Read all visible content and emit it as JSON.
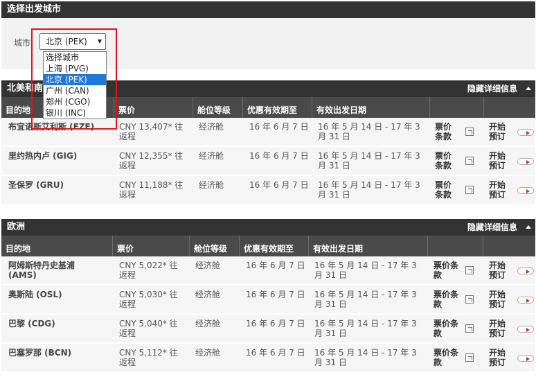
{
  "city_section": {
    "title": "选择出发城市",
    "city_label": "城市",
    "selected": "北京 (PEK)",
    "options": [
      "选择城市",
      "上海 (PVG)",
      "北京 (PEK)",
      "广州 (CAN)",
      "郑州 (CGO)",
      "银川 (INC)"
    ],
    "selected_index": 2
  },
  "sections": [
    {
      "title": "北美和南",
      "toggle": "隐藏详细信息",
      "headers": [
        "目的地",
        "票价",
        "舱位等级",
        "优惠有效期至",
        "有效出发日期"
      ],
      "rows": [
        {
          "dest": "布宜诺斯艾利斯 (EZE)",
          "fare": "CNY 13,407* 往返程",
          "cabin": "经济舱",
          "valid_until": "16 年 6 月 7 日",
          "travel": "16 年 5 月 14 日 - 17 年 3 月 31 日",
          "terms": "票价条款",
          "book": "开始预订"
        },
        {
          "dest": "里约热内卢 (GIG)",
          "fare": "CNY 12,355* 往返程",
          "cabin": "经济舱",
          "valid_until": "16 年 6 月 7 日",
          "travel": "16 年 5 月 14 日 - 17 年 3 月 31 日",
          "terms": "票价条款",
          "book": "开始预订"
        },
        {
          "dest": "圣保罗 (GRU)",
          "fare": "CNY 11,188* 往返程",
          "cabin": "经济舱",
          "valid_until": "16 年 6 月 7 日",
          "travel": "16 年 5 月 14 日 - 17 年 3 月 31 日",
          "terms": "票价条款",
          "book": "开始预订"
        }
      ]
    },
    {
      "title": "欧洲",
      "toggle": "隐藏详细信息",
      "headers": [
        "目的地",
        "票价",
        "舱位等级",
        "优惠有效期至",
        "有效出发日期"
      ],
      "rows": [
        {
          "dest": "阿姆斯特丹史基浦 (AMS)",
          "fare": "CNY 5,022* 往返程",
          "cabin": "经济舱",
          "valid_until": "16 年 6 月 7 日",
          "travel": "16 年 5 月 14 日 - 17 年 3 月 31 日",
          "terms": "票价条款",
          "book": "开始预订"
        },
        {
          "dest": "奥斯陆 (OSL)",
          "fare": "CNY 5,030* 往返程",
          "cabin": "经济舱",
          "valid_until": "16 年 6 月 7 日",
          "travel": "16 年 5 月 14 日 - 17 年 3 月 31 日",
          "terms": "票价条款",
          "book": "开始预订"
        },
        {
          "dest": "巴黎 (CDG)",
          "fare": "CNY 5,040* 往返程",
          "cabin": "经济舱",
          "valid_until": "16 年 6 月 7 日",
          "travel": "16 年 5 月 14 日 - 17 年 3 月 31 日",
          "terms": "票价条款",
          "book": "开始预订"
        },
        {
          "dest": "巴塞罗那 (BCN)",
          "fare": "CNY 5,112* 往返程",
          "cabin": "经济舱",
          "valid_until": "16 年 6 月 7 日",
          "travel": "16 年 5 月 14 日 - 17 年 3 月 31 日",
          "terms": "票价条款",
          "book": "开始预订"
        }
      ]
    }
  ]
}
